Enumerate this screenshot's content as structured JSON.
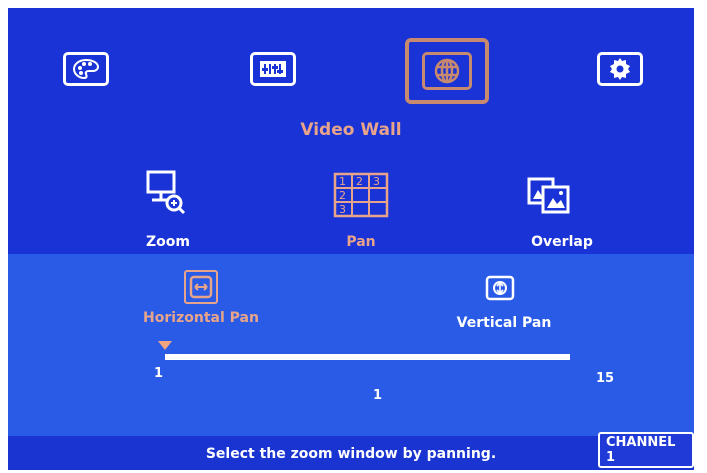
{
  "colors": {
    "background": "#1a32d8",
    "submenu_band": "#2a5be6",
    "selected_accent": "#e7a48a",
    "text": "#ffffff"
  },
  "top_menu": {
    "items": [
      {
        "icon": "palette-icon"
      },
      {
        "icon": "adjust-icon"
      },
      {
        "icon": "globe-icon",
        "selected": true
      },
      {
        "icon": "gear-icon"
      }
    ],
    "title": "Video Wall"
  },
  "submenu": {
    "items": [
      {
        "label": "Zoom",
        "icon": "zoom-icon"
      },
      {
        "label": "Pan",
        "icon": "pan-grid-icon",
        "selected": true
      },
      {
        "label": "Overlap",
        "icon": "overlap-icon"
      }
    ]
  },
  "pan_options": {
    "horizontal": {
      "label": "Horizontal Pan",
      "selected": true,
      "icon": "horizontal-pan-icon"
    },
    "vertical": {
      "label": "Vertical Pan",
      "icon": "vertical-pan-icon"
    }
  },
  "slider": {
    "min": "1",
    "max": "15",
    "value": "1",
    "value_fraction": 0
  },
  "status": {
    "channel_badge": "CHANNEL 1",
    "message": "Select the zoom window by panning."
  }
}
